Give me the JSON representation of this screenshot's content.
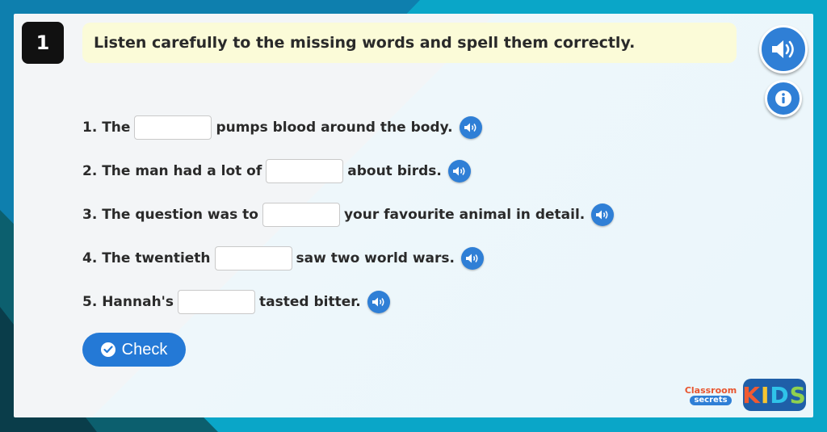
{
  "question": {
    "number": "1",
    "instruction": "Listen carefully to the missing words and spell them correctly."
  },
  "icons": {
    "main_audio": "speaker-icon",
    "info": "info-icon",
    "sentence_audio": "speaker-icon",
    "check": "checkmark-icon"
  },
  "sentences": [
    {
      "before": "1. The",
      "after": "pumps blood around the body.",
      "answer": ""
    },
    {
      "before": "2. The man had a lot of",
      "after": "about birds.",
      "answer": ""
    },
    {
      "before": "3. The question was to",
      "after": "your favourite animal in detail.",
      "answer": ""
    },
    {
      "before": "4. The twentieth",
      "after": "saw two world wars.",
      "answer": ""
    },
    {
      "before": "5. Hannah's",
      "after": "tasted bitter.",
      "answer": ""
    }
  ],
  "check_button": {
    "label": "Check"
  },
  "logos": {
    "classroom_line1": "Classroom",
    "classroom_line2": "secrets",
    "kids_letters": [
      "K",
      "I",
      "D",
      "S"
    ]
  },
  "colors": {
    "accent_blue": "#2f7fd6",
    "banner": "#fbfbd8",
    "frame": "#0aa6c8"
  }
}
